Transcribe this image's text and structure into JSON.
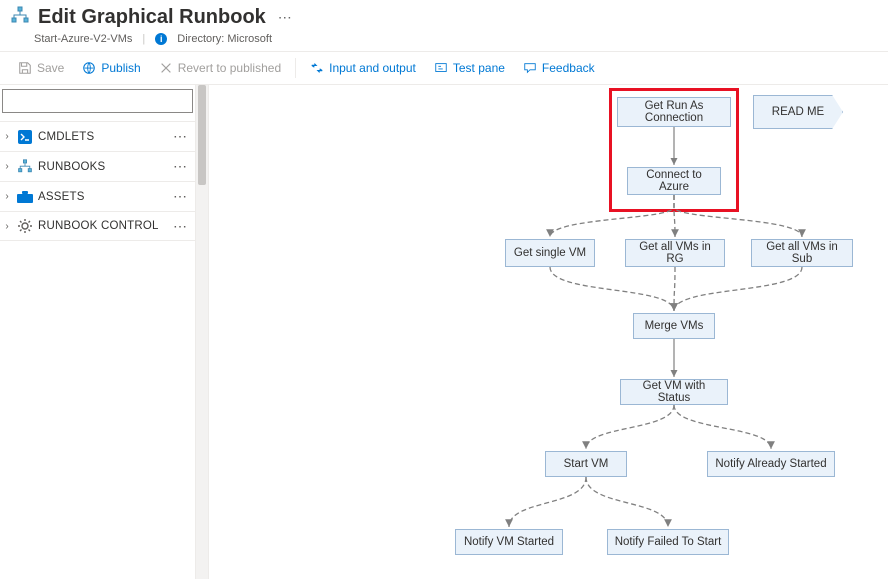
{
  "header": {
    "title": "Edit Graphical Runbook",
    "subtitle_name": "Start-Azure-V2-VMs",
    "directory_label": "Directory: Microsoft"
  },
  "toolbar": {
    "save": "Save",
    "publish": "Publish",
    "revert": "Revert to published",
    "io": "Input and output",
    "testpane": "Test pane",
    "feedback": "Feedback"
  },
  "library": [
    {
      "label": "CMDLETS",
      "icon_bg": "#0078d4",
      "icon_name": "cmdlets-icon"
    },
    {
      "label": "RUNBOOKS",
      "icon_bg": "#ffffff",
      "icon_name": "runbooks-icon"
    },
    {
      "label": "ASSETS",
      "icon_bg": "#0078d4",
      "icon_name": "assets-icon"
    },
    {
      "label": "RUNBOOK CONTROL",
      "icon_bg": "#ffffff",
      "icon_name": "gear-icon"
    }
  ],
  "nodes": {
    "get_conn": "Get Run As Connection",
    "readme": "READ ME",
    "connect": "Connect to Azure",
    "single_vm": "Get single VM",
    "vms_rg": "Get all VMs in RG",
    "vms_sub": "Get all VMs in Sub",
    "merge": "Merge VMs",
    "status": "Get VM with Status",
    "start": "Start VM",
    "already": "Notify Already Started",
    "started": "Notify VM Started",
    "failed": "Notify Failed To Start"
  }
}
